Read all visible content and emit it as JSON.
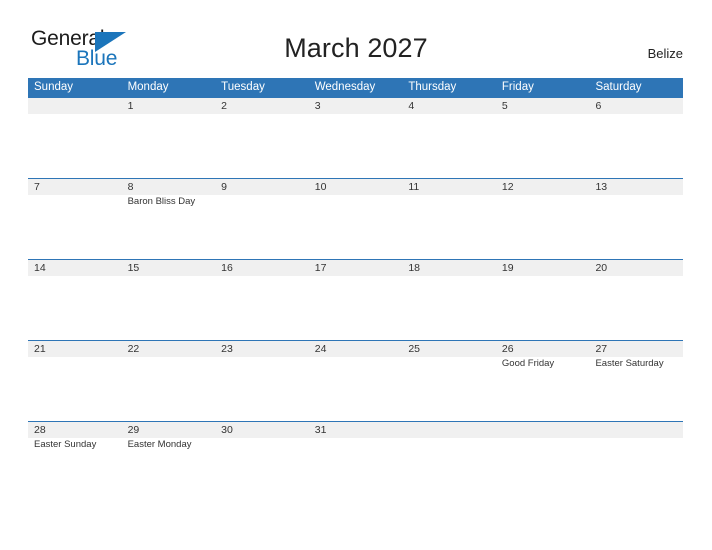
{
  "brand": {
    "word_general": "General",
    "word_blue": "Blue",
    "accent_color": "#1b75bb",
    "triangle_icon": "triangle-logo-icon"
  },
  "header": {
    "title": "March 2027",
    "country": "Belize"
  },
  "calendar": {
    "header_bg": "#2e75b6",
    "date_band_bg": "#f0f0f0",
    "weekdays": [
      "Sunday",
      "Monday",
      "Tuesday",
      "Wednesday",
      "Thursday",
      "Friday",
      "Saturday"
    ],
    "weeks": [
      [
        {
          "date": "",
          "event": ""
        },
        {
          "date": "1",
          "event": ""
        },
        {
          "date": "2",
          "event": ""
        },
        {
          "date": "3",
          "event": ""
        },
        {
          "date": "4",
          "event": ""
        },
        {
          "date": "5",
          "event": ""
        },
        {
          "date": "6",
          "event": ""
        }
      ],
      [
        {
          "date": "7",
          "event": ""
        },
        {
          "date": "8",
          "event": "Baron Bliss Day"
        },
        {
          "date": "9",
          "event": ""
        },
        {
          "date": "10",
          "event": ""
        },
        {
          "date": "11",
          "event": ""
        },
        {
          "date": "12",
          "event": ""
        },
        {
          "date": "13",
          "event": ""
        }
      ],
      [
        {
          "date": "14",
          "event": ""
        },
        {
          "date": "15",
          "event": ""
        },
        {
          "date": "16",
          "event": ""
        },
        {
          "date": "17",
          "event": ""
        },
        {
          "date": "18",
          "event": ""
        },
        {
          "date": "19",
          "event": ""
        },
        {
          "date": "20",
          "event": ""
        }
      ],
      [
        {
          "date": "21",
          "event": ""
        },
        {
          "date": "22",
          "event": ""
        },
        {
          "date": "23",
          "event": ""
        },
        {
          "date": "24",
          "event": ""
        },
        {
          "date": "25",
          "event": ""
        },
        {
          "date": "26",
          "event": "Good Friday"
        },
        {
          "date": "27",
          "event": "Easter Saturday"
        }
      ],
      [
        {
          "date": "28",
          "event": "Easter Sunday"
        },
        {
          "date": "29",
          "event": "Easter Monday"
        },
        {
          "date": "30",
          "event": ""
        },
        {
          "date": "31",
          "event": ""
        },
        {
          "date": "",
          "event": ""
        },
        {
          "date": "",
          "event": ""
        },
        {
          "date": "",
          "event": ""
        }
      ]
    ]
  }
}
